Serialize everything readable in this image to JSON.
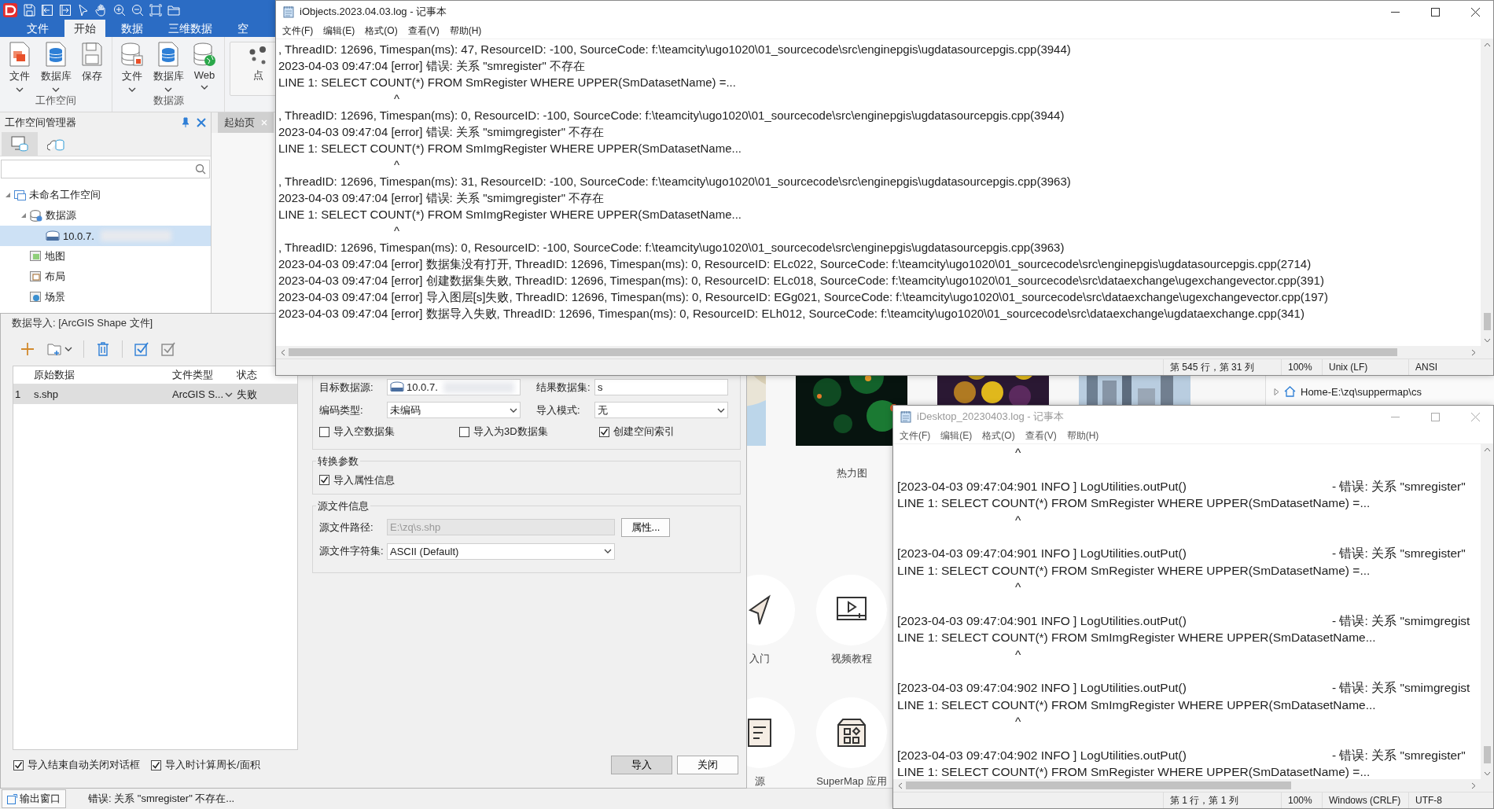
{
  "app": {
    "ribbon_tabs": [
      {
        "label": "文件",
        "selected": false
      },
      {
        "label": "开始",
        "selected": true
      },
      {
        "label": "数据",
        "selected": false
      },
      {
        "label": "三维数据",
        "selected": false
      },
      {
        "label": "空",
        "selected": false
      }
    ],
    "ribbon_groups": [
      {
        "label": "工作空间",
        "buttons": [
          {
            "label": "文件",
            "kind": "file",
            "dropdown": true
          },
          {
            "label": "数据库",
            "kind": "database",
            "dropdown": true
          },
          {
            "label": "保存",
            "kind": "save",
            "dropdown": false
          }
        ]
      },
      {
        "label": "数据源",
        "buttons": [
          {
            "label": "文件",
            "kind": "file-db",
            "dropdown": true
          },
          {
            "label": "数据库",
            "kind": "database",
            "dropdown": true
          },
          {
            "label": "Web",
            "kind": "web",
            "dropdown": true
          }
        ]
      },
      {
        "buttons": [
          {
            "label": "点",
            "kind": "points",
            "dropdown": false
          }
        ]
      }
    ],
    "workspace_panel": {
      "title": "工作空间管理器",
      "tabs": [
        {
          "kind": "local",
          "selected": true
        },
        {
          "kind": "cloud",
          "selected": false
        }
      ],
      "tree": [
        {
          "label": "未命名工作空间",
          "kind": "workspace",
          "expanded": true,
          "selected": false,
          "children": [
            {
              "label": "数据源",
              "kind": "datasources",
              "expanded": true,
              "selected": false,
              "children": [
                {
                  "label": "10.0.7.",
                  "kind": "pgis",
                  "selected": true,
                  "redacted": true
                }
              ]
            },
            {
              "label": "地图",
              "kind": "map",
              "selected": false
            },
            {
              "label": "布局",
              "kind": "layout",
              "selected": false
            },
            {
              "label": "场景",
              "kind": "scene",
              "selected": false
            }
          ]
        }
      ]
    },
    "start_page": {
      "tab": "起始页",
      "gallery": [
        {
          "kind": "picture"
        },
        {
          "kind": "picture",
          "label": "热力图"
        },
        {
          "kind": "picture"
        },
        {
          "kind": "picture"
        }
      ],
      "shortcuts": [
        {
          "kind": "plane",
          "label": "入门"
        },
        {
          "kind": "video",
          "label": "视频教程"
        },
        {
          "kind": "document",
          "label": "源"
        },
        {
          "kind": "apps",
          "label": "SuperMap 应用"
        }
      ],
      "file_browser": {
        "path": "Home-E:\\zq\\suppermap\\cs"
      }
    },
    "status_bar": {
      "output_button": "输出窗口",
      "message": "错误: 关系 \"smregister\" 不存在..."
    }
  },
  "import_dialog": {
    "title": "数据导入: [ArcGIS Shape 文件]",
    "table": {
      "columns": [
        "原始数据",
        "文件类型",
        "状态"
      ],
      "rows": [
        {
          "index": "1",
          "source": "s.shp",
          "file_type": "ArcGIS S...",
          "status": "失败",
          "selected": true
        }
      ]
    },
    "target_datasource": {
      "label": "目标数据源:",
      "value": "10.0.7.",
      "redacted": true
    },
    "result_dataset": {
      "label": "结果数据集:",
      "value": "s"
    },
    "encoding": {
      "label": "编码类型:",
      "value": "未编码"
    },
    "import_mode": {
      "label": "导入模式:",
      "value": "无"
    },
    "options": [
      {
        "label": "导入空数据集",
        "checked": false
      },
      {
        "label": "导入为3D数据集",
        "checked": false
      },
      {
        "label": "创建空间索引",
        "checked": true
      }
    ],
    "conversion": {
      "title": "转换参数",
      "options": [
        {
          "label": "导入属性信息",
          "checked": true
        }
      ]
    },
    "source_info": {
      "title": "源文件信息",
      "path": {
        "label": "源文件路径:",
        "value": "E:\\zq\\s.shp",
        "disabled": true
      },
      "properties_button": "属性...",
      "charset": {
        "label": "源文件字符集:",
        "value": "ASCII (Default)"
      }
    },
    "footer_options": [
      {
        "label": "导入结束自动关闭对话框",
        "checked": true
      },
      {
        "label": "导入时计算周长/面积",
        "checked": true
      }
    ],
    "buttons": [
      {
        "label": "导入",
        "default": true
      },
      {
        "label": "关闭",
        "default": false
      }
    ]
  },
  "notepads": [
    {
      "title": "iObjects.2023.04.03.log - 记事本",
      "active": true,
      "menu": [
        "文件(F)",
        "编辑(E)",
        "格式(O)",
        "查看(V)",
        "帮助(H)"
      ],
      "lines": [
        {
          "kind": "text",
          "text": ", ThreadID: 12696, Timespan(ms): 47, ResourceID: -100, SourceCode: f:\\teamcity\\ugo1020\\01_sourcecode\\src\\enginepgis\\ugdatasourcepgis.cpp(3944)"
        },
        {
          "kind": "text",
          "text": "2023-04-03 09:47:04 [error] 错误: 关系 \"smregister\" 不存在"
        },
        {
          "kind": "text",
          "text": "LINE 1: SELECT COUNT(*) FROM SmRegister WHERE UPPER(SmDatasetName) =..."
        },
        {
          "kind": "caret",
          "text": "^"
        },
        {
          "kind": "text",
          "text": ", ThreadID: 12696, Timespan(ms): 0, ResourceID: -100, SourceCode: f:\\teamcity\\ugo1020\\01_sourcecode\\src\\enginepgis\\ugdatasourcepgis.cpp(3944)"
        },
        {
          "kind": "text",
          "text": "2023-04-03 09:47:04 [error] 错误: 关系 \"smimgregister\" 不存在"
        },
        {
          "kind": "text",
          "text": "LINE 1: SELECT COUNT(*) FROM SmImgRegister WHERE UPPER(SmDatasetName..."
        },
        {
          "kind": "caret",
          "text": "^"
        },
        {
          "kind": "text",
          "text": ", ThreadID: 12696, Timespan(ms): 31, ResourceID: -100, SourceCode: f:\\teamcity\\ugo1020\\01_sourcecode\\src\\enginepgis\\ugdatasourcepgis.cpp(3963)"
        },
        {
          "kind": "text",
          "text": "2023-04-03 09:47:04 [error] 错误: 关系 \"smimgregister\" 不存在"
        },
        {
          "kind": "text",
          "text": "LINE 1: SELECT COUNT(*) FROM SmImgRegister WHERE UPPER(SmDatasetName..."
        },
        {
          "kind": "caret",
          "text": "^"
        },
        {
          "kind": "text",
          "text": ", ThreadID: 12696, Timespan(ms): 0, ResourceID: -100, SourceCode: f:\\teamcity\\ugo1020\\01_sourcecode\\src\\enginepgis\\ugdatasourcepgis.cpp(3963)"
        },
        {
          "kind": "text",
          "text": "2023-04-03 09:47:04 [error] 数据集没有打开, ThreadID: 12696, Timespan(ms): 0, ResourceID: ELc022, SourceCode: f:\\teamcity\\ugo1020\\01_sourcecode\\src\\enginepgis\\ugdatasourcepgis.cpp(2714)"
        },
        {
          "kind": "text",
          "text": "2023-04-03 09:47:04 [error] 创建数据集失败, ThreadID: 12696, Timespan(ms): 0, ResourceID: ELc018, SourceCode: f:\\teamcity\\ugo1020\\01_sourcecode\\src\\dataexchange\\ugexchangevector.cpp(391)"
        },
        {
          "kind": "text",
          "text": "2023-04-03 09:47:04 [error] 导入图层[s]失败, ThreadID: 12696, Timespan(ms): 0, ResourceID: EGg021, SourceCode: f:\\teamcity\\ugo1020\\01_sourcecode\\src\\dataexchange\\ugexchangevector.cpp(197)"
        },
        {
          "kind": "text",
          "text": "2023-04-03 09:47:04 [error] 数据导入失败, ThreadID: 12696, Timespan(ms): 0, ResourceID: ELh012, SourceCode: f:\\teamcity\\ugo1020\\01_sourcecode\\src\\dataexchange\\ugdataexchange.cpp(341)"
        }
      ],
      "status": [
        "第 545 行，第 31 列",
        "100%",
        "Unix (LF)",
        "ANSI"
      ]
    },
    {
      "title": "iDesktop_20230403.log - 记事本",
      "active": false,
      "menu": [
        "文件(F)",
        "编辑(E)",
        "格式(O)",
        "查看(V)",
        "帮助(H)"
      ],
      "lines": [
        {
          "kind": "caret",
          "text": "^"
        },
        {
          "kind": "blank"
        },
        {
          "kind": "entry",
          "text": "[2023-04-03 09:47:04:901 INFO ] LogUtilities.outPut()",
          "message": "- 错误: 关系 \"smregister\""
        },
        {
          "kind": "text",
          "text": "LINE 1: SELECT COUNT(*) FROM SmRegister WHERE UPPER(SmDatasetName) =..."
        },
        {
          "kind": "caret",
          "text": "^"
        },
        {
          "kind": "blank"
        },
        {
          "kind": "entry",
          "text": "[2023-04-03 09:47:04:901 INFO ] LogUtilities.outPut()",
          "message": "- 错误: 关系 \"smregister\""
        },
        {
          "kind": "text",
          "text": "LINE 1: SELECT COUNT(*) FROM SmRegister WHERE UPPER(SmDatasetName) =..."
        },
        {
          "kind": "caret",
          "text": "^"
        },
        {
          "kind": "blank"
        },
        {
          "kind": "entry",
          "text": "[2023-04-03 09:47:04:901 INFO ] LogUtilities.outPut()",
          "message": "- 错误: 关系 \"smimgregist"
        },
        {
          "kind": "text",
          "text": "LINE 1: SELECT COUNT(*) FROM SmImgRegister WHERE UPPER(SmDatasetName..."
        },
        {
          "kind": "caret",
          "text": "^"
        },
        {
          "kind": "blank"
        },
        {
          "kind": "entry",
          "text": "[2023-04-03 09:47:04:902 INFO ] LogUtilities.outPut()",
          "message": "- 错误: 关系 \"smimgregist"
        },
        {
          "kind": "text",
          "text": "LINE 1: SELECT COUNT(*) FROM SmImgRegister WHERE UPPER(SmDatasetName..."
        },
        {
          "kind": "caret",
          "text": "^"
        },
        {
          "kind": "blank"
        },
        {
          "kind": "entry",
          "text": "[2023-04-03 09:47:04:902 INFO ] LogUtilities.outPut()",
          "message": "- 错误: 关系 \"smregister\""
        },
        {
          "kind": "text",
          "text": "LINE 1: SELECT COUNT(*) FROM SmRegister WHERE UPPER(SmDatasetName) =..."
        }
      ],
      "status": [
        "第 1 行，第 1 列",
        "100%",
        "Windows (CRLF)",
        "UTF-8"
      ]
    }
  ]
}
